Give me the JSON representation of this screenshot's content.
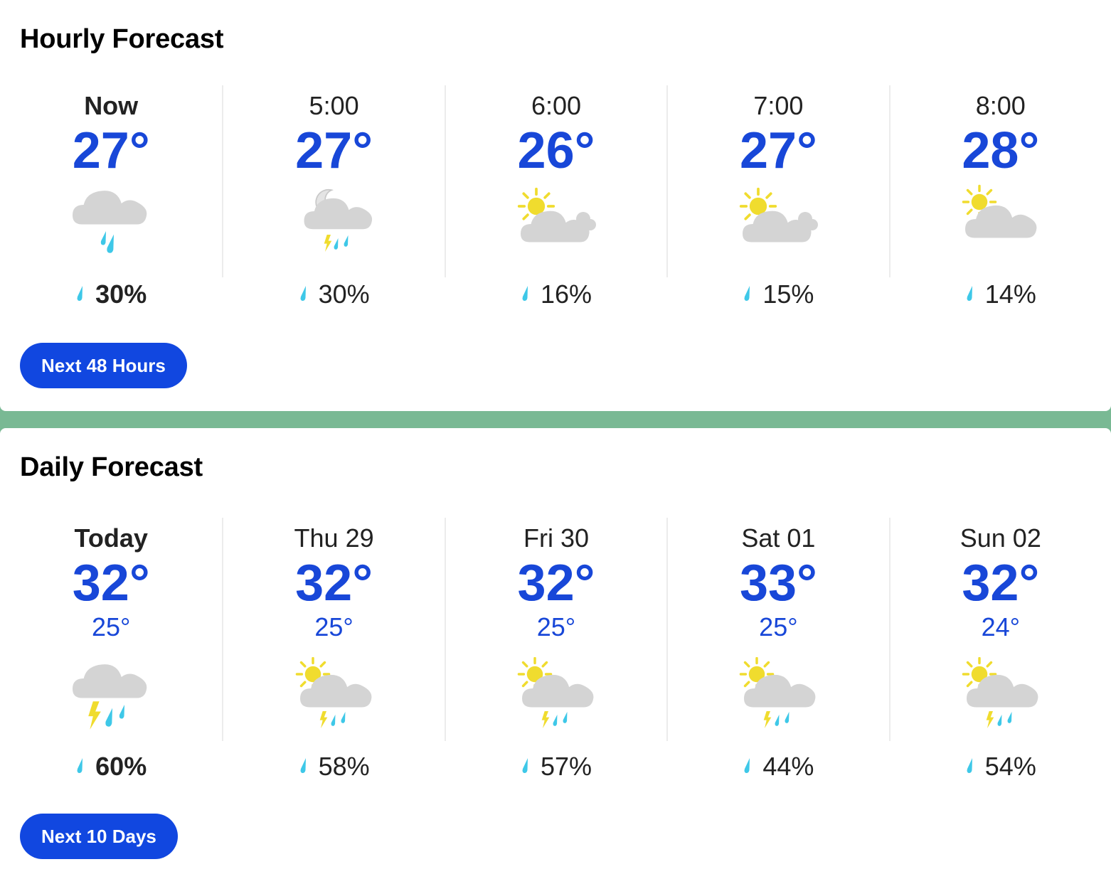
{
  "hourly": {
    "title": "Hourly Forecast",
    "button_label": "Next 48 Hours",
    "items": [
      {
        "label": "Now",
        "temp": "27°",
        "precip": "30%",
        "icon": "cloud-rain-icon"
      },
      {
        "label": "5:00",
        "temp": "27°",
        "precip": "30%",
        "icon": "moon-cloud-thunderstorm-icon"
      },
      {
        "label": "6:00",
        "temp": "26°",
        "precip": "16%",
        "icon": "sun-clouds-icon"
      },
      {
        "label": "7:00",
        "temp": "27°",
        "precip": "15%",
        "icon": "sun-clouds-icon"
      },
      {
        "label": "8:00",
        "temp": "28°",
        "precip": "14%",
        "icon": "partly-cloudy-icon"
      }
    ]
  },
  "daily": {
    "title": "Daily Forecast",
    "button_label": "Next 10 Days",
    "items": [
      {
        "label": "Today",
        "high": "32°",
        "low": "25°",
        "precip": "60%",
        "icon": "cloud-thunderstorm-icon"
      },
      {
        "label": "Thu 29",
        "high": "32°",
        "low": "25°",
        "precip": "58%",
        "icon": "sun-cloud-thunderstorm-icon"
      },
      {
        "label": "Fri 30",
        "high": "32°",
        "low": "25°",
        "precip": "57%",
        "icon": "sun-cloud-thunderstorm-icon"
      },
      {
        "label": "Sat 01",
        "high": "33°",
        "low": "25°",
        "precip": "44%",
        "icon": "sun-cloud-thunderstorm-icon"
      },
      {
        "label": "Sun 02",
        "high": "32°",
        "low": "24°",
        "precip": "54%",
        "icon": "sun-cloud-thunderstorm-icon"
      }
    ]
  },
  "colors": {
    "accent": "#1147e0",
    "temperature": "#1847d8",
    "background": "#79b994",
    "cloud": "#d4d4d4",
    "sun": "#f0dc2e",
    "rain": "#3ec8e8"
  }
}
